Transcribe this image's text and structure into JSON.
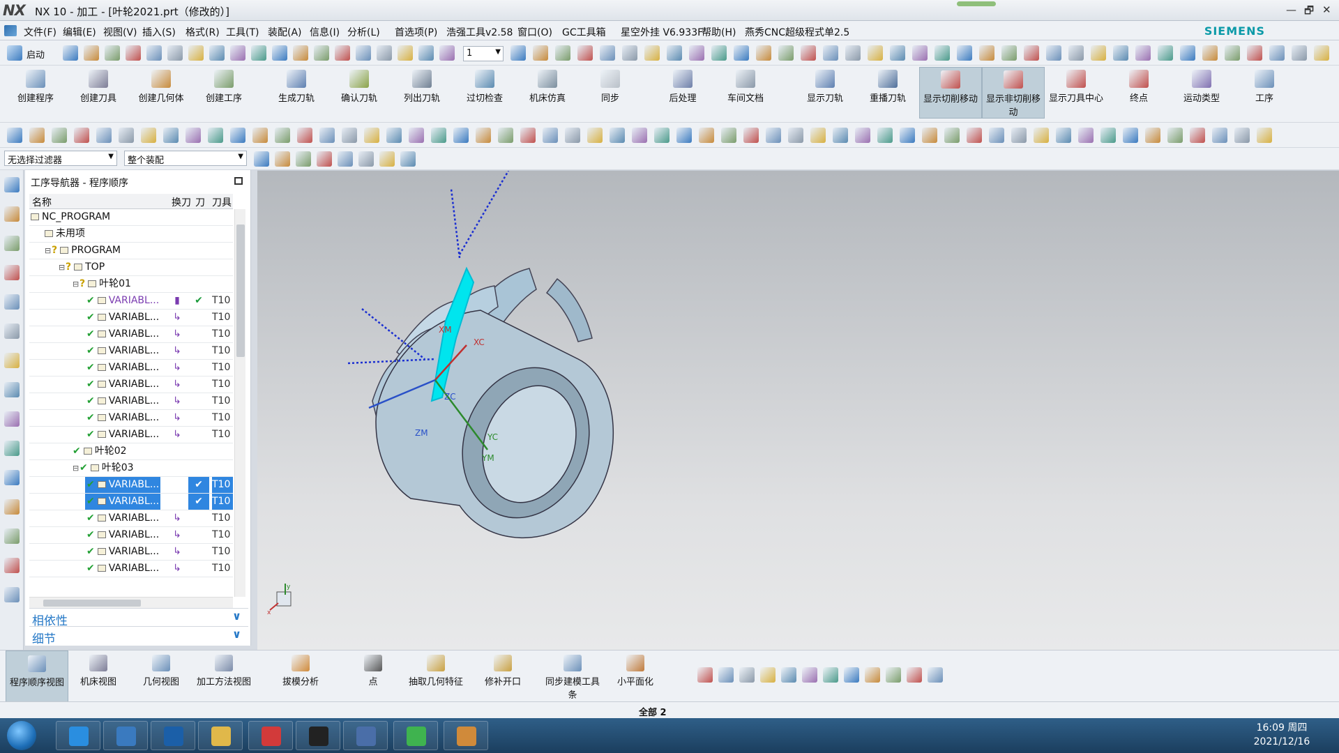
{
  "window": {
    "logo": "NX",
    "title": "NX 10 - 加工 - [叶轮2021.prt（修改的）]",
    "brand": "SIEMENS",
    "min": "—",
    "restore": "🗗",
    "close": "✕"
  },
  "menu": [
    "文件(F)",
    "编辑(E)",
    "视图(V)",
    "插入(S)",
    "格式(R)",
    "工具(T)",
    "装配(A)",
    "信息(I)",
    "分析(L)",
    "首选项(P)",
    "浩强工具v2.58",
    "窗口(O)",
    "GC工具箱",
    "星空外挂 V6.933F",
    "帮助(H)",
    "燕秀CNC超级程式单2.5"
  ],
  "toolbar": {
    "start_label": "启动",
    "layer_value": "1"
  },
  "ribbon": [
    {
      "label": "创建程序",
      "color": "#6a8fb8"
    },
    {
      "label": "创建刀具",
      "color": "#7d7d96"
    },
    {
      "label": "创建几何体",
      "color": "#c78a3a"
    },
    {
      "label": "创建工序",
      "color": "#7a9c6a"
    },
    {
      "label": "生成刀轨",
      "color": "#5d7fb0"
    },
    {
      "label": "确认刀轨",
      "color": "#8aa248"
    },
    {
      "label": "列出刀轨",
      "color": "#6f7f92"
    },
    {
      "label": "过切检查",
      "color": "#5a8ab0"
    },
    {
      "label": "机床仿真",
      "color": "#7b8e9e"
    },
    {
      "label": "同步",
      "color": "#b9c0c8"
    },
    {
      "label": "后处理",
      "color": "#6d7ea8"
    },
    {
      "label": "车间文档",
      "color": "#8a98a8"
    },
    {
      "label": "显示刀轨",
      "color": "#5d7fb0"
    },
    {
      "label": "重播刀轨",
      "color": "#4f6f9a"
    },
    {
      "label": "显示切削移动",
      "color": "#c0504d"
    },
    {
      "label": "显示非切削移动",
      "color": "#c0504d"
    },
    {
      "label": "显示刀具中心",
      "color": "#c0504d"
    },
    {
      "label": "终点",
      "color": "#c0504d"
    },
    {
      "label": "运动类型",
      "color": "#7f6fb0"
    },
    {
      "label": "工序",
      "color": "#6a8fb8"
    }
  ],
  "filters": {
    "type_filter": "无选择过滤器",
    "scope_filter": "整个装配"
  },
  "navigator": {
    "title": "工序导航器 - 程序顺序",
    "columns": [
      "名称",
      "换刀",
      "刀",
      "刀具"
    ],
    "rows": [
      {
        "indent": 0,
        "exp": "",
        "mark": "",
        "name": "NC_PROGRAM",
        "change": "",
        "path": "",
        "tool": "",
        "selected": false,
        "purple": false
      },
      {
        "indent": 1,
        "exp": "",
        "mark": "",
        "name": "未用项",
        "change": "",
        "path": "",
        "tool": "",
        "selected": false,
        "purple": false
      },
      {
        "indent": 1,
        "exp": "⊟",
        "mark": "?",
        "name": "PROGRAM",
        "change": "",
        "path": "",
        "tool": "",
        "selected": false,
        "purple": false
      },
      {
        "indent": 2,
        "exp": "⊟",
        "mark": "?",
        "name": "TOP",
        "change": "",
        "path": "",
        "tool": "",
        "selected": false,
        "purple": false
      },
      {
        "indent": 3,
        "exp": "⊟",
        "mark": "?",
        "name": "叶轮01",
        "change": "",
        "path": "",
        "tool": "",
        "selected": false,
        "purple": false
      },
      {
        "indent": 4,
        "exp": "",
        "mark": "✔",
        "name": "VARIABL...",
        "change": "▮",
        "path": "✔",
        "tool": "T10",
        "selected": false,
        "purple": true
      },
      {
        "indent": 4,
        "exp": "",
        "mark": "✔",
        "name": "VARIABL...",
        "change": "↳",
        "path": "",
        "tool": "T10",
        "selected": false,
        "purple": false
      },
      {
        "indent": 4,
        "exp": "",
        "mark": "✔",
        "name": "VARIABL...",
        "change": "↳",
        "path": "",
        "tool": "T10",
        "selected": false,
        "purple": false
      },
      {
        "indent": 4,
        "exp": "",
        "mark": "✔",
        "name": "VARIABL...",
        "change": "↳",
        "path": "",
        "tool": "T10",
        "selected": false,
        "purple": false
      },
      {
        "indent": 4,
        "exp": "",
        "mark": "✔",
        "name": "VARIABL...",
        "change": "↳",
        "path": "",
        "tool": "T10",
        "selected": false,
        "purple": false
      },
      {
        "indent": 4,
        "exp": "",
        "mark": "✔",
        "name": "VARIABL...",
        "change": "↳",
        "path": "",
        "tool": "T10",
        "selected": false,
        "purple": false
      },
      {
        "indent": 4,
        "exp": "",
        "mark": "✔",
        "name": "VARIABL...",
        "change": "↳",
        "path": "",
        "tool": "T10",
        "selected": false,
        "purple": false
      },
      {
        "indent": 4,
        "exp": "",
        "mark": "✔",
        "name": "VARIABL...",
        "change": "↳",
        "path": "",
        "tool": "T10",
        "selected": false,
        "purple": false
      },
      {
        "indent": 4,
        "exp": "",
        "mark": "✔",
        "name": "VARIABL...",
        "change": "↳",
        "path": "",
        "tool": "T10",
        "selected": false,
        "purple": false
      },
      {
        "indent": 3,
        "exp": "",
        "mark": "✔",
        "name": "叶轮02",
        "change": "",
        "path": "",
        "tool": "",
        "selected": false,
        "purple": false
      },
      {
        "indent": 3,
        "exp": "⊟",
        "mark": "✔",
        "name": "叶轮03",
        "change": "",
        "path": "",
        "tool": "",
        "selected": false,
        "purple": false
      },
      {
        "indent": 4,
        "exp": "",
        "mark": "✔",
        "name": "VARIABL...",
        "change": "",
        "path": "✔",
        "tool": "T10",
        "selected": true,
        "purple": false
      },
      {
        "indent": 4,
        "exp": "",
        "mark": "✔",
        "name": "VARIABL...",
        "change": "",
        "path": "✔",
        "tool": "T10",
        "selected": true,
        "purple": false
      },
      {
        "indent": 4,
        "exp": "",
        "mark": "✔",
        "name": "VARIABL...",
        "change": "↳",
        "path": "",
        "tool": "T10",
        "selected": false,
        "purple": false
      },
      {
        "indent": 4,
        "exp": "",
        "mark": "✔",
        "name": "VARIABL...",
        "change": "↳",
        "path": "",
        "tool": "T10",
        "selected": false,
        "purple": false
      },
      {
        "indent": 4,
        "exp": "",
        "mark": "✔",
        "name": "VARIABL...",
        "change": "↳",
        "path": "",
        "tool": "T10",
        "selected": false,
        "purple": false
      },
      {
        "indent": 4,
        "exp": "",
        "mark": "✔",
        "name": "VARIABL...",
        "change": "↳",
        "path": "",
        "tool": "T10",
        "selected": false,
        "purple": false
      }
    ],
    "panels": [
      {
        "label": "相依性",
        "arrow": "∨"
      },
      {
        "label": "细节",
        "arrow": "∨"
      }
    ]
  },
  "viewport": {
    "axis_labels": {
      "xm": "XM",
      "xc": "XC",
      "zc": "ZC",
      "yc": "YC",
      "ym": "YM",
      "zm": "ZM"
    },
    "triad_x": "x",
    "triad_y": "y"
  },
  "bottom": [
    {
      "label": "程序顺序视图",
      "color": "#6a8fb8"
    },
    {
      "label": "机床视图",
      "color": "#7d7d96"
    },
    {
      "label": "几何视图",
      "color": "#6a8fb8"
    },
    {
      "label": "加工方法视图",
      "color": "#7a8aa8"
    },
    {
      "label": "拔模分析",
      "color": "#d08a3a"
    },
    {
      "label": "点",
      "color": "#555555"
    },
    {
      "label": "抽取几何特征",
      "color": "#c9a040"
    },
    {
      "label": "修补开口",
      "color": "#c9a040"
    },
    {
      "label": "同步建模工具条",
      "color": "#6a8fb8"
    },
    {
      "label": "小平面化",
      "color": "#c07a3a"
    }
  ],
  "status": "全部 2",
  "clock": {
    "time": "16:09 周四",
    "date": "2021/12/16"
  }
}
